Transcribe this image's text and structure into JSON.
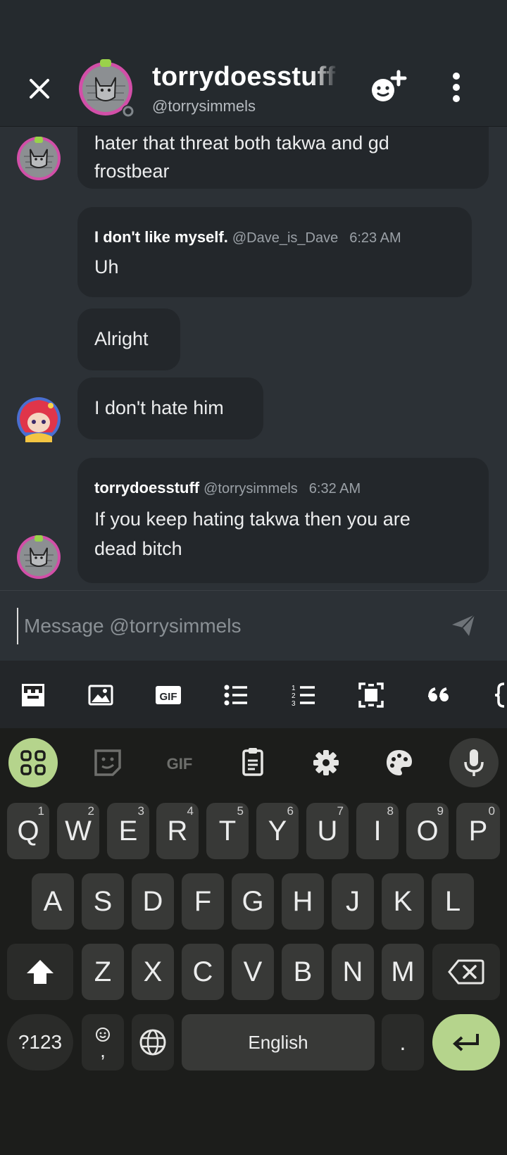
{
  "header": {
    "title": "torrydoesstuff",
    "username": "@torrysimmels"
  },
  "messages": [
    {
      "text_lines": [
        "hater that threat both takwa and gd",
        "frostbear"
      ]
    },
    {
      "author": "I don't like myself.",
      "handle": "@Dave_is_Dave",
      "time": "6:23 AM",
      "text": "Uh"
    },
    {
      "text": "Alright"
    },
    {
      "text": "I don't hate him"
    },
    {
      "author": "torrydoesstuff",
      "handle": "@torrysimmels",
      "time": "6:32 AM",
      "text_lines": [
        "If you keep hating takwa then you are",
        "dead bitch"
      ]
    }
  ],
  "composer": {
    "placeholder": "Message @torrysimmels",
    "value": ""
  },
  "toolbar": {
    "icons": [
      "emoji-panel-icon",
      "image-icon",
      "gif-icon",
      "bullet-list-icon",
      "numbered-list-icon",
      "spoiler-icon",
      "quote-icon",
      "code-icon"
    ]
  },
  "keyboard": {
    "suggestion_icons": [
      "apps-grid-icon",
      "sticker-icon",
      "gif-icon",
      "clipboard-icon",
      "settings-icon",
      "theme-palette-icon",
      "microphone-icon"
    ],
    "row1": [
      [
        "Q",
        "1"
      ],
      [
        "W",
        "2"
      ],
      [
        "E",
        "3"
      ],
      [
        "R",
        "4"
      ],
      [
        "T",
        "5"
      ],
      [
        "Y",
        "6"
      ],
      [
        "U",
        "7"
      ],
      [
        "I",
        "8"
      ],
      [
        "O",
        "9"
      ],
      [
        "P",
        "0"
      ]
    ],
    "row2": [
      "A",
      "S",
      "D",
      "F",
      "G",
      "H",
      "J",
      "K",
      "L"
    ],
    "row3": [
      "Z",
      "X",
      "C",
      "V",
      "B",
      "N",
      "M"
    ],
    "mode_label": "?123",
    "space_label": "English",
    "period_label": ".",
    "comma_label": ",",
    "accent": "#b5d48c"
  }
}
